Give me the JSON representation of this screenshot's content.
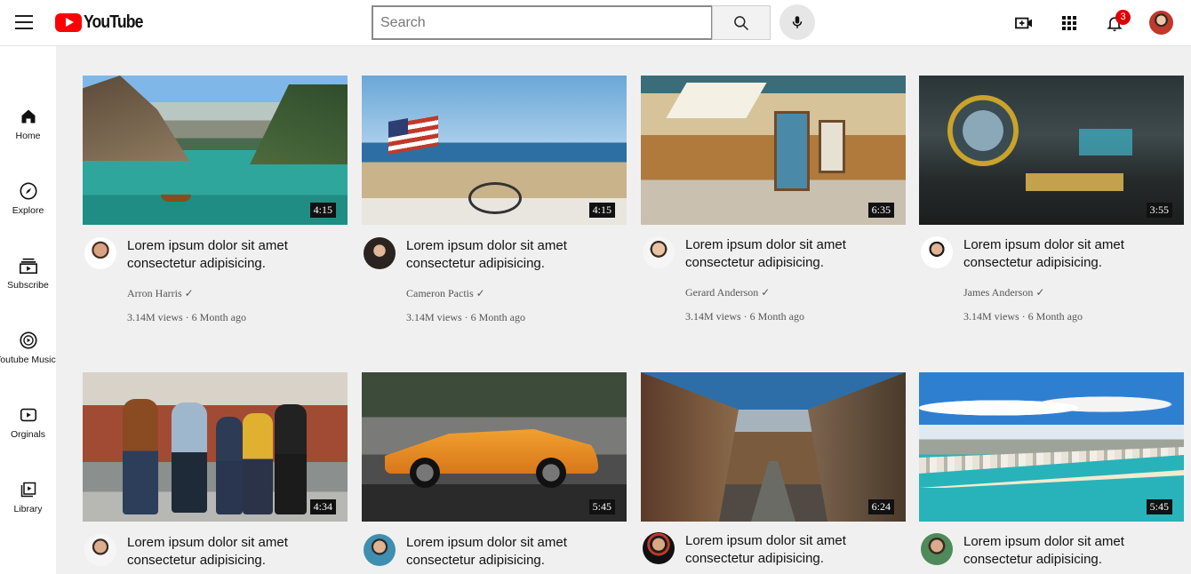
{
  "app": {
    "logo_text": "YouTube"
  },
  "header": {
    "search_placeholder": "Search",
    "notification_count": "3"
  },
  "sidebar": {
    "items": [
      {
        "label": "Home",
        "icon": "home-icon"
      },
      {
        "label": "Explore",
        "icon": "compass-icon"
      },
      {
        "label": "Subscribe",
        "icon": "subscriptions-icon"
      },
      {
        "label": "Youtube Music",
        "icon": "music-icon"
      },
      {
        "label": "Orginals",
        "icon": "originals-icon"
      },
      {
        "label": "Library",
        "icon": "library-icon"
      }
    ]
  },
  "videos": [
    {
      "title": "Lorem ipsum dolor sit amet consectetur adipisicing.",
      "channel": "Arron Harris ✓",
      "meta": "3.14M views · 6 Month ago",
      "duration": "4:15"
    },
    {
      "title": "Lorem ipsum dolor sit amet consectetur adipisicing.",
      "channel": "Cameron Pactis ✓",
      "meta": "3.14M views · 6 Month ago",
      "duration": "4:15"
    },
    {
      "title": "Lorem ipsum dolor sit amet consectetur adipisicing.",
      "channel": "Gerard Anderson ✓",
      "meta": "3.14M views · 6 Month ago",
      "duration": "6:35"
    },
    {
      "title": "Lorem ipsum dolor sit amet consectetur adipisicing.",
      "channel": "James Anderson ✓",
      "meta": "3.14M views · 6 Month ago",
      "duration": "3:55"
    },
    {
      "title": "Lorem ipsum dolor sit amet consectetur adipisicing.",
      "channel": "",
      "meta": "",
      "duration": "4:34"
    },
    {
      "title": "Lorem ipsum dolor sit amet consectetur adipisicing.",
      "channel": "",
      "meta": "",
      "duration": "5:45"
    },
    {
      "title": "Lorem ipsum dolor sit amet consectetur adipisicing.",
      "channel": "",
      "meta": "",
      "duration": "6:24"
    },
    {
      "title": "Lorem ipsum dolor sit amet consectetur adipisicing.",
      "channel": "",
      "meta": "",
      "duration": "5:45"
    }
  ],
  "colors": {
    "brand_red": "#ff0000",
    "badge_red": "#dd0000",
    "page_bg": "#f0f0f0"
  }
}
